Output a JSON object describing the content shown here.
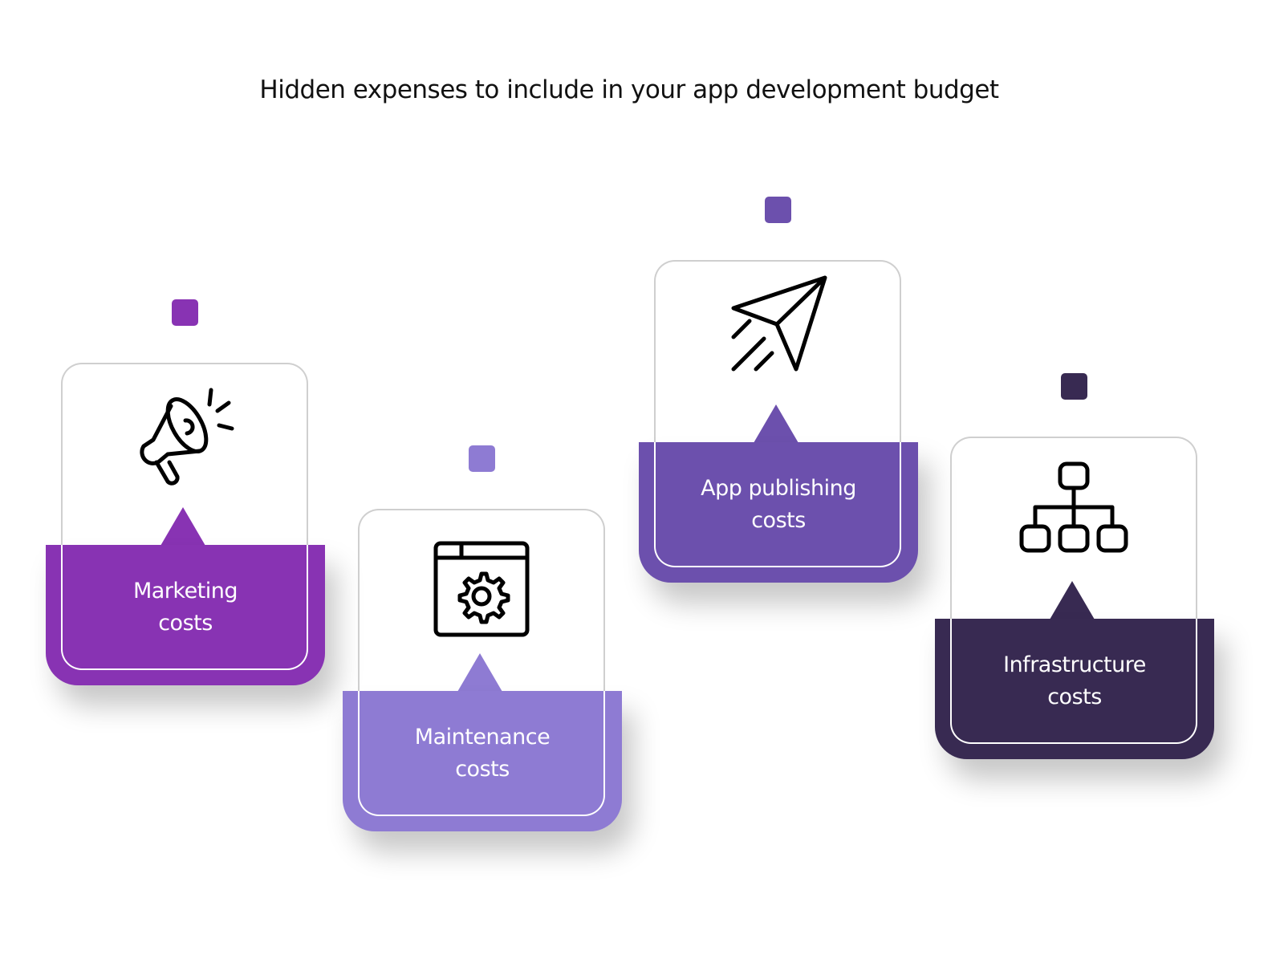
{
  "title": "Hidden expenses to include in your app development budget",
  "cards": [
    {
      "line1": "Marketing",
      "line2": "costs",
      "color": "#8833B3",
      "icon": "megaphone-icon"
    },
    {
      "line1": "Maintenance",
      "line2": "costs",
      "color": "#8E7BD3",
      "icon": "browser-gear-icon"
    },
    {
      "line1": "App publishing",
      "line2": "costs",
      "color": "#6C50AD",
      "icon": "paper-plane-icon"
    },
    {
      "line1": "Infrastructure",
      "line2": "costs",
      "color": "#382A52",
      "icon": "hierarchy-icon"
    }
  ]
}
